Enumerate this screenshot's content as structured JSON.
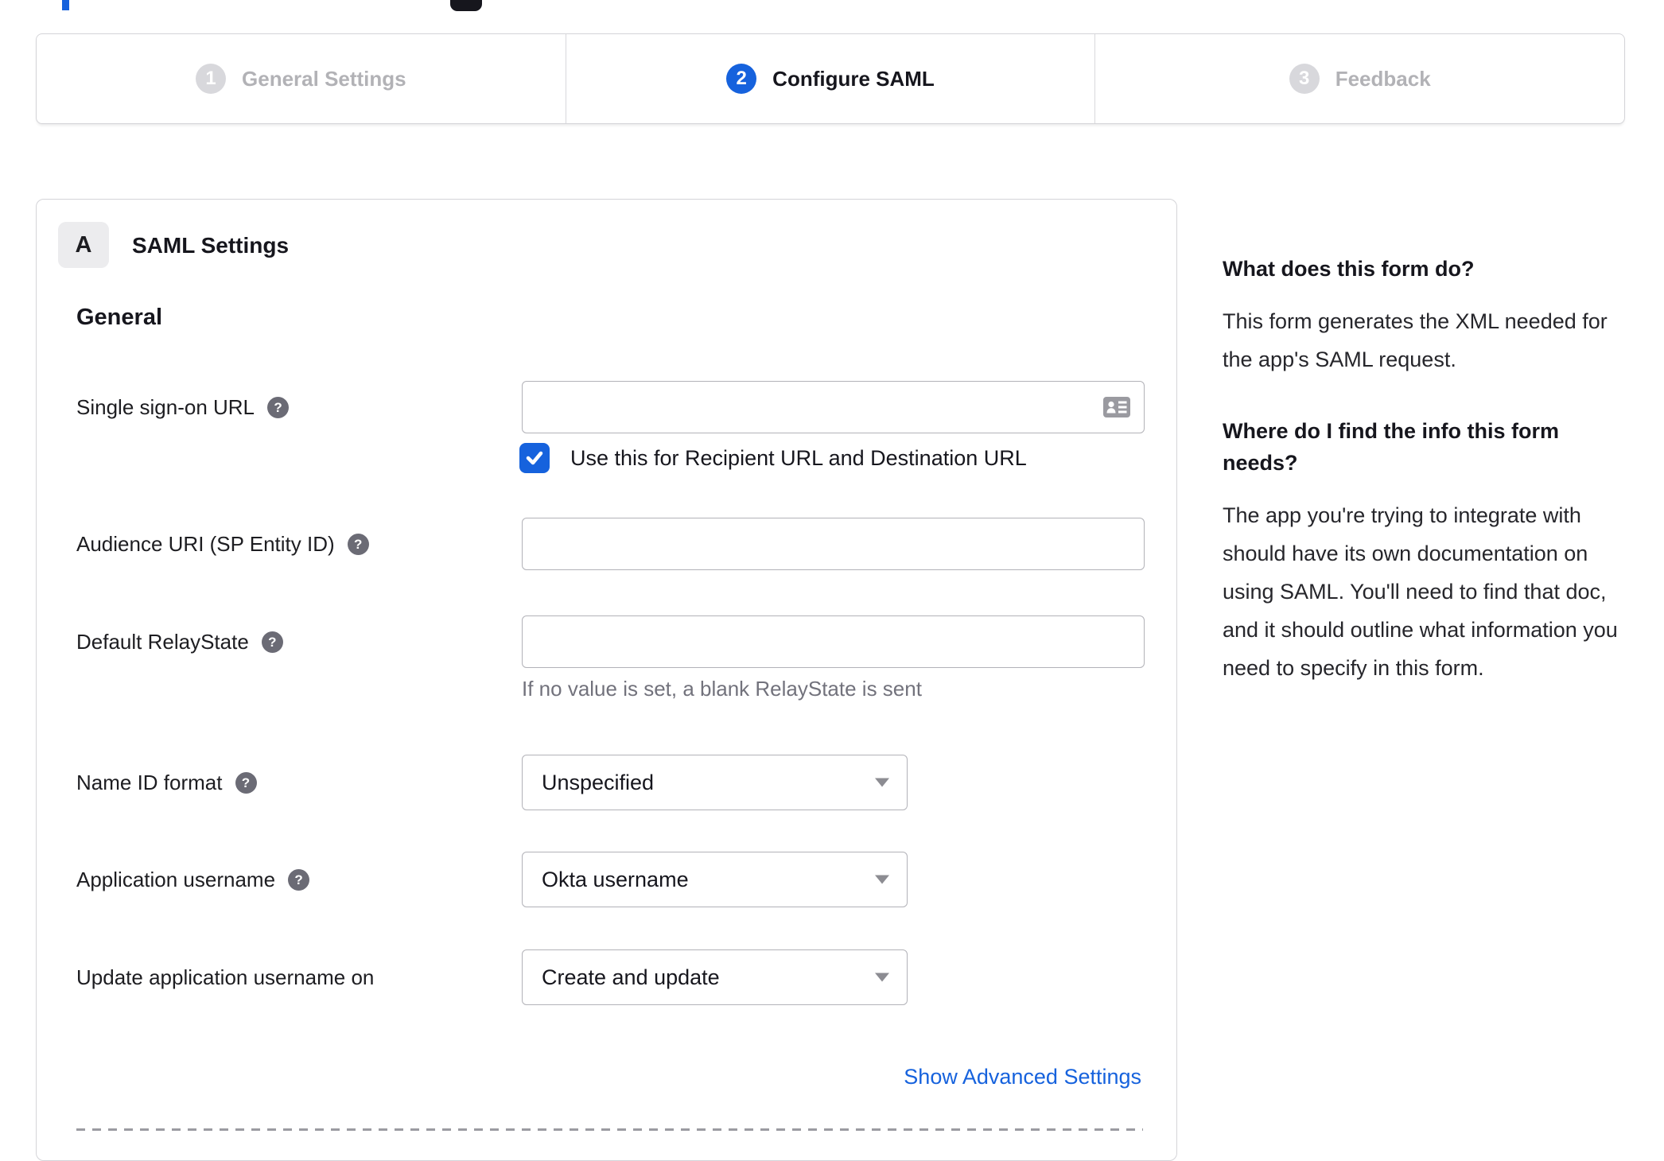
{
  "stepper": {
    "active_step": "2",
    "steps": [
      {
        "number": "1",
        "label": "General Settings"
      },
      {
        "number": "2",
        "label": "Configure SAML"
      },
      {
        "number": "3",
        "label": "Feedback"
      }
    ]
  },
  "panel": {
    "badge": "A",
    "title": "SAML Settings",
    "section": "General",
    "fields": {
      "sso": {
        "label": "Single sign-on URL",
        "value": "",
        "checkbox_label": "Use this for Recipient URL and Destination URL",
        "checkbox_checked": true
      },
      "audience": {
        "label": "Audience URI (SP Entity ID)",
        "value": ""
      },
      "relay": {
        "label": "Default RelayState",
        "value": "",
        "hint": "If no value is set, a blank RelayState is sent"
      },
      "name_id": {
        "label": "Name ID format",
        "value": "Unspecified"
      },
      "app_user": {
        "label": "Application username",
        "value": "Okta username"
      },
      "update_user": {
        "label": "Update application username on",
        "value": "Create and update"
      }
    },
    "advanced_link": "Show Advanced Settings"
  },
  "sidebar": {
    "q1_title": "What does this form do?",
    "q1_body": "This form generates the XML needed for the app's SAML request.",
    "q2_title": "Where do I find the info this form needs?",
    "q2_body": "The app you're trying to integrate with should have its own documentation on using SAML. You'll need to find that doc, and it should outline what information you need to specify in this form."
  },
  "icons": {
    "help_glyph": "?"
  },
  "colors": {
    "accent_blue": "#1662dd",
    "inactive_gray": "#d8d8dc",
    "border_gray": "#d4d4d8",
    "hint_text": "#72727c"
  }
}
